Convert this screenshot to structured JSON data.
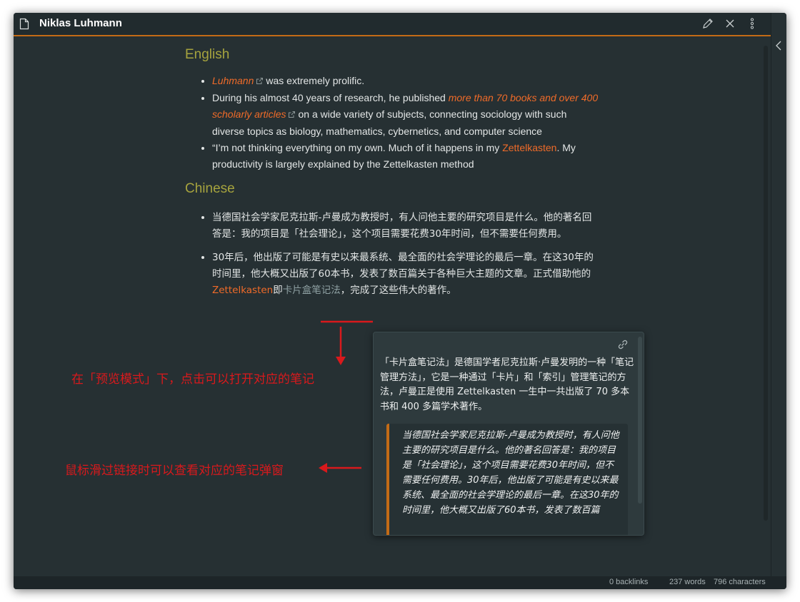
{
  "window": {
    "title": "Niklas Luhmann",
    "icons": [
      "document-icon",
      "pencil-icon",
      "close-icon",
      "more-vertical-icon",
      "chevron-left-icon"
    ]
  },
  "note": {
    "english_heading": "English",
    "english_items": {
      "item1_link": "Luhmann",
      "item1_text": "was extremely prolific.",
      "item2_pre": "During his almost 40 years of research, he published ",
      "item2_link": "more than 70 books and over 400 scholarly articles",
      "item2_post": "on a wide variety of subjects, connecting sociology with such diverse topics as biology, mathematics, cybernetics, and computer science",
      "item3_pre": "“I’m not thinking everything on my own. Much of it happens in my ",
      "item3_link": "Zettelkasten",
      "item3_post": ". My productivity is largely explained by the Zettelkasten method"
    },
    "chinese_heading": "Chinese",
    "chinese_items": {
      "item1": "当德国社会学家尼克拉斯-卢曼成为教授时，有人问他主要的研究项目是什么。他的著名回答是：我的项目是「社会理论」，这个项目需要花费30年时间，但不需要任何费用。",
      "item2_pre": "30年后，他出版了可能是有史以来最系统、最全面的社会学理论的最后一章。在这30年的时间里，他大概又出版了60本书，发表了数百篇关于各种巨大主题的文章。正式借助他的",
      "item2_link1": "Zettelkasten",
      "item2_mid": "即",
      "item2_link2": "卡片盒笔记法",
      "item2_post": "，完成了这些伟大的著作。"
    }
  },
  "popover": {
    "paragraph": "「卡片盒笔记法」是德国学者尼克拉斯·卢曼发明的一种「笔记管理方法」，它是一种通过「卡片」和「索引」管理笔记的方法，卢曼正是使用 Zettelkasten 一生中一共出版了 70 多本书和 400 多篇学术著作。",
    "quote": "当德国社会学家尼克拉斯-卢曼成为教授时，有人问他主要的研究项目是什么。他的著名回答是：我的项目是「社会理论」，这个项目需要花费30年时间，但不需要任何费用。30年后，他出版了可能是有史以来最系统、最全面的社会学理论的最后一章。在这30年的时间里，他大概又出版了60本书，发表了数百篇",
    "icon": "link-icon"
  },
  "annotations": {
    "click_hint": "在「预览模式」下，点击可以打开对应的笔记",
    "hover_hint": "鼠标滑过链接时可以查看对应的笔记弹窗"
  },
  "status": {
    "backlinks": "0 backlinks",
    "words": "237 words",
    "characters": "796 characters"
  },
  "colors": {
    "background": "#263033",
    "accent": "#c36b16",
    "heading": "#a6a33e",
    "link": "#f06b29",
    "annotation": "#d9191c"
  }
}
